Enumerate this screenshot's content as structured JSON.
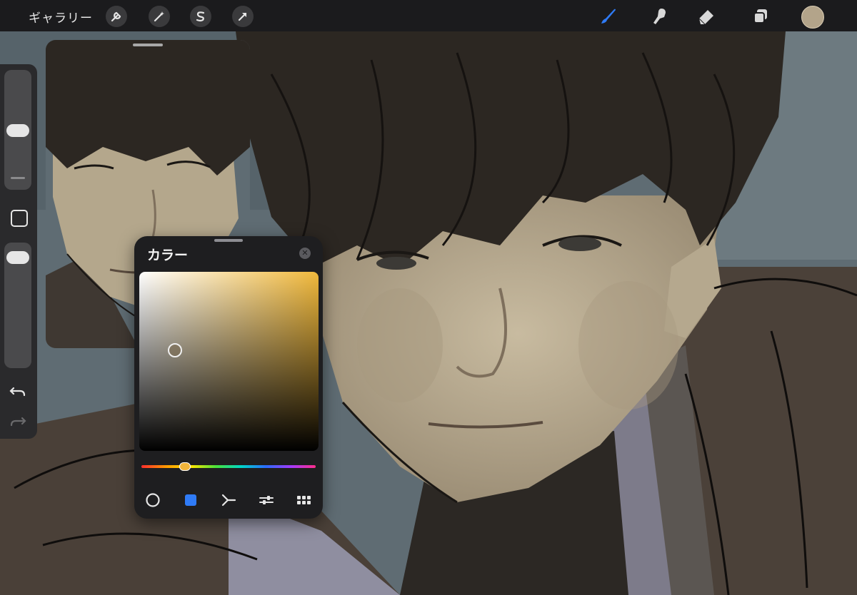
{
  "toolbar": {
    "gallery_label": "ギャラリー",
    "left_tools": [
      "wrench-icon",
      "magic-wand-icon",
      "selection-icon",
      "transform-arrow-icon"
    ],
    "right_tools": [
      "brush-icon",
      "smudge-icon",
      "eraser-icon",
      "layers-icon"
    ],
    "active_tool": "brush-icon",
    "current_color": "#b3a48a",
    "accent": "#2f7bf6"
  },
  "sidebar": {
    "brush_size_level": 0.45,
    "opacity_level": 0.05,
    "buttons": [
      "modify-square",
      "undo-icon",
      "redo-icon"
    ]
  },
  "color_panel": {
    "title": "カラー",
    "hue_position": 0.25,
    "saturation": 0.2,
    "brightness": 0.56,
    "hue_color": "#f1b93c",
    "tabs": [
      "disc-icon",
      "classic-icon",
      "harmony-icon",
      "value-icon",
      "palettes-icon"
    ],
    "active_tab": "classic-icon"
  }
}
